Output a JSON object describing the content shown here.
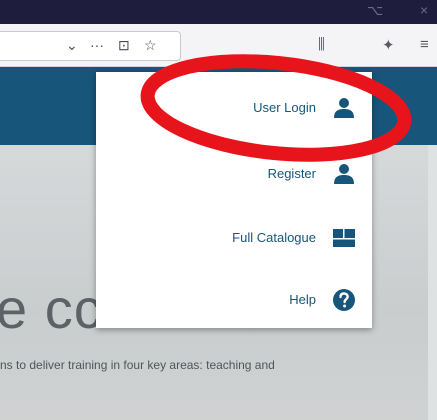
{
  "browser": {
    "titlebar_glyph": "⌥",
    "close_glyph": "×",
    "url_icons": {
      "chevron": "⌄",
      "more": "···",
      "pocket": "⊡",
      "star": "☆"
    },
    "toolbar_icons": {
      "library": "⫼",
      "extension": "✦",
      "menu": "≡"
    }
  },
  "page": {
    "hero_text": "e cc",
    "body_text": "ns to deliver training in four key areas: teaching and"
  },
  "menu": {
    "items": [
      {
        "label": "User Login",
        "icon": "user-icon"
      },
      {
        "label": "Register",
        "icon": "user-icon"
      },
      {
        "label": "Full Catalogue",
        "icon": "catalogue-icon"
      },
      {
        "label": "Help",
        "icon": "help-icon"
      }
    ]
  },
  "colors": {
    "brand": "#17557a",
    "titlebar": "#1f1d3e",
    "annotation": "#e8141b"
  }
}
